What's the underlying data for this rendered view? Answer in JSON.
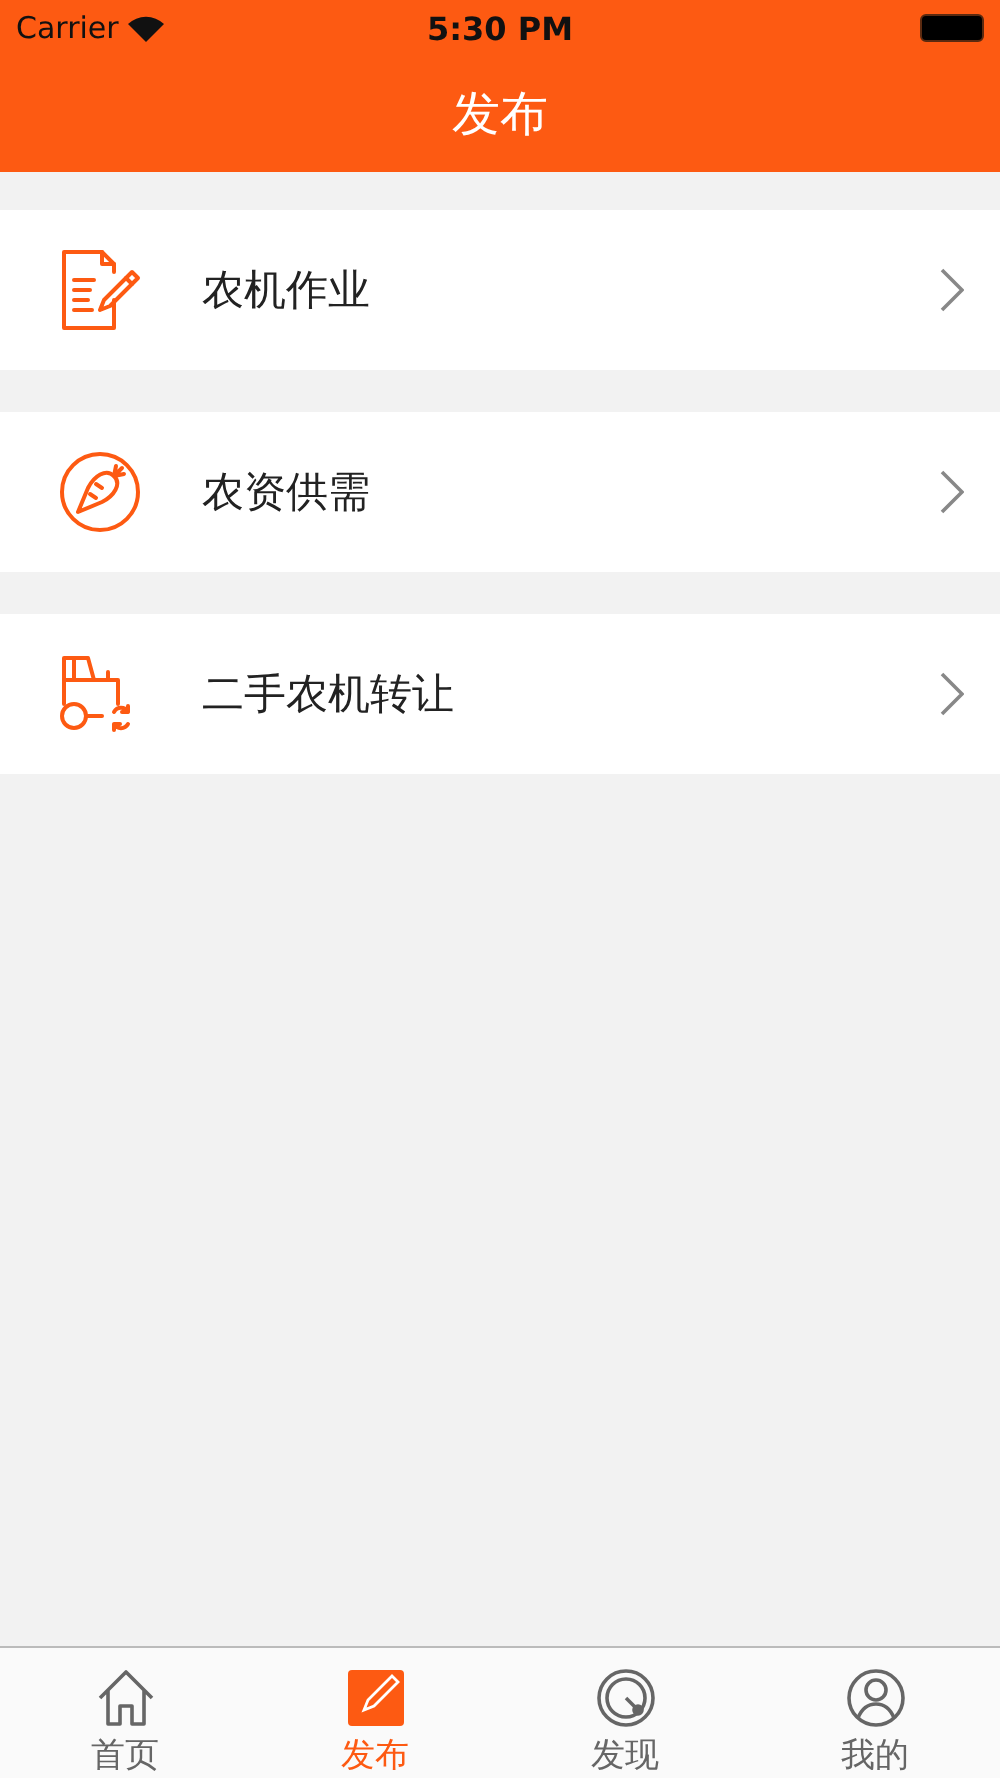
{
  "status_bar": {
    "carrier": "Carrier",
    "time": "5:30 PM"
  },
  "nav_bar": {
    "title": "发布"
  },
  "menu_items": [
    {
      "kind": "document",
      "label": "农机作业"
    },
    {
      "kind": "carrot",
      "label": "农资供需"
    },
    {
      "kind": "tractor",
      "label": "二手农机转让"
    }
  ],
  "tab_bar": [
    {
      "kind": "home",
      "label": "首页",
      "selected": false
    },
    {
      "kind": "publish",
      "label": "发布",
      "selected": true
    },
    {
      "kind": "discover",
      "label": "发现",
      "selected": false
    },
    {
      "kind": "profile",
      "label": "我的",
      "selected": false
    }
  ]
}
